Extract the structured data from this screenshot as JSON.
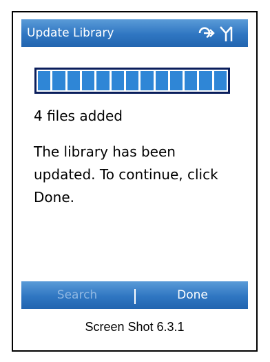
{
  "window": {
    "title": "Update Library"
  },
  "status_icons": [
    "connectivity-icon",
    "signal-strength-icon"
  ],
  "progress": {
    "value": 1.0,
    "segments": 13,
    "color": "#2f86d6"
  },
  "content": {
    "files_added": "4 files added",
    "message": "The library has been updated. To continue, click Done."
  },
  "softkeys": {
    "left": "Search",
    "right": "Done"
  },
  "caption": "Screen Shot 6.3.1",
  "colors": {
    "bar_blue": "#2f76c2",
    "disabled_text": "#8fb7e2"
  }
}
